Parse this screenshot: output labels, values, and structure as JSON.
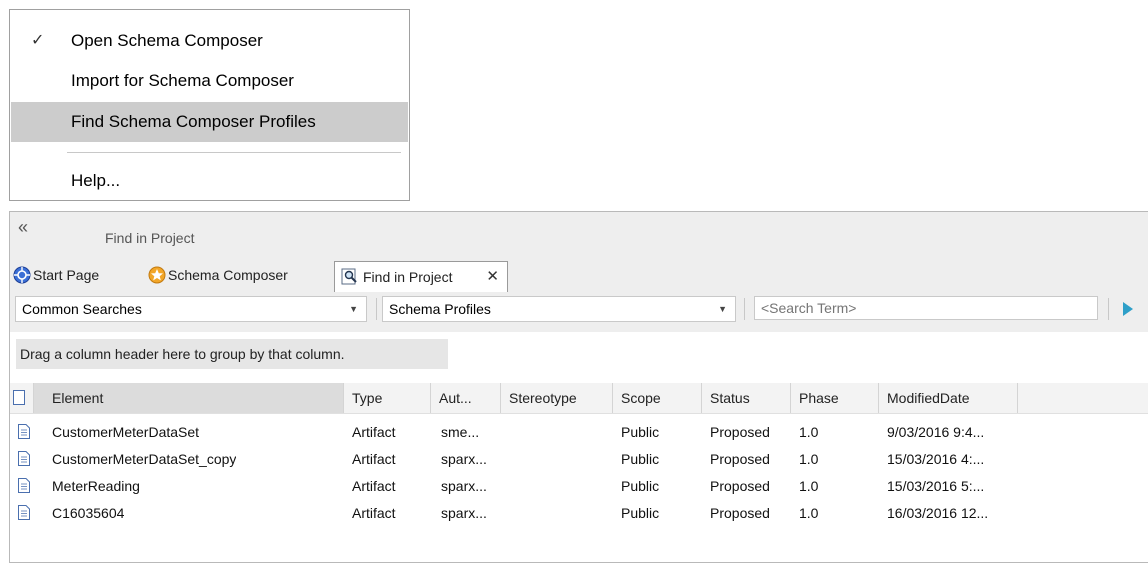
{
  "menu": {
    "items": [
      {
        "label": "Open Schema Composer",
        "checked": true,
        "highlighted": false
      },
      {
        "label": "Import for Schema Composer",
        "checked": false,
        "highlighted": false
      },
      {
        "label": "Find Schema Composer Profiles",
        "checked": false,
        "highlighted": true
      },
      {
        "label": "Help...",
        "checked": false,
        "highlighted": false
      }
    ],
    "check_glyph": "✓"
  },
  "window": {
    "collapse_glyph": "«",
    "title": "Find in Project",
    "tabs": [
      {
        "label": "Start Page",
        "icon": "start-page-icon"
      },
      {
        "label": "Schema Composer",
        "icon": "schema-composer-icon"
      },
      {
        "label": "Find in Project",
        "icon": "find-in-project-icon",
        "active": true
      }
    ],
    "close_glyph": "✕"
  },
  "toolbar": {
    "common_searches": "Common Searches",
    "search_name": "Schema Profiles",
    "search_term_placeholder": "<Search Term>",
    "dropdown_glyph": "▼"
  },
  "group_hint": "Drag a column header here to group by that column.",
  "columns": [
    "Element",
    "Type",
    "Aut...",
    "Stereotype",
    "Scope",
    "Status",
    "Phase",
    "ModifiedDate"
  ],
  "rows": [
    {
      "element": "CustomerMeterDataSet",
      "type": "Artifact",
      "author": "sme...",
      "stereotype": "",
      "scope": "Public",
      "status": "Proposed",
      "phase": "1.0",
      "modified": "9/03/2016 9:4..."
    },
    {
      "element": "CustomerMeterDataSet_copy",
      "type": "Artifact",
      "author": "sparx...",
      "stereotype": "",
      "scope": "Public",
      "status": "Proposed",
      "phase": "1.0",
      "modified": "15/03/2016 4:..."
    },
    {
      "element": "MeterReading",
      "type": "Artifact",
      "author": "sparx...",
      "stereotype": "",
      "scope": "Public",
      "status": "Proposed",
      "phase": "1.0",
      "modified": "15/03/2016 5:..."
    },
    {
      "element": "C16035604",
      "type": "Artifact",
      "author": "sparx...",
      "stereotype": "",
      "scope": "Public",
      "status": "Proposed",
      "phase": "1.0",
      "modified": "16/03/2016 12..."
    }
  ],
  "colors": {
    "highlight": "#cccccc",
    "accent": "#2e9fc8",
    "toolbar_bg": "#eeeeee"
  }
}
